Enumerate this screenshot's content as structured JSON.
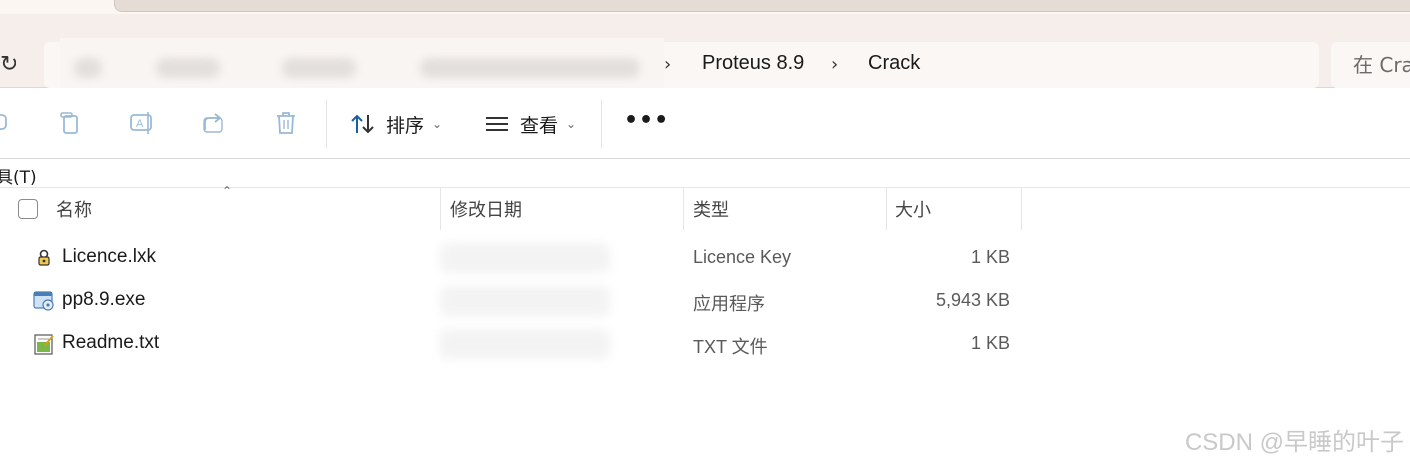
{
  "breadcrumb": {
    "items": [
      "Proteus 8.9",
      "Crack"
    ]
  },
  "search": {
    "placeholder": "在 Crack 中搜索"
  },
  "command_bar": {
    "sort_label": "排序",
    "view_label": "查看",
    "more_label": "•••",
    "icons": [
      "copy-icon",
      "paste-icon",
      "rename-icon",
      "share-icon",
      "delete-icon"
    ]
  },
  "menu": {
    "tools_label": "具(T)"
  },
  "columns": {
    "name": "名称",
    "modified": "修改日期",
    "type": "类型",
    "size": "大小"
  },
  "files": [
    {
      "name": "Licence.lxk",
      "type": "Licence Key",
      "size": "1 KB",
      "icon": "licence-key-icon"
    },
    {
      "name": "pp8.9.exe",
      "type": "应用程序",
      "size": "5,943 KB",
      "icon": "exe-app-icon"
    },
    {
      "name": "Readme.txt",
      "type": "TXT 文件",
      "size": "1 KB",
      "icon": "text-file-icon"
    }
  ],
  "watermark": "CSDN @早睡的叶子",
  "colors": {
    "address_bg": "#f6eeea",
    "accent": "#1a73c8"
  }
}
